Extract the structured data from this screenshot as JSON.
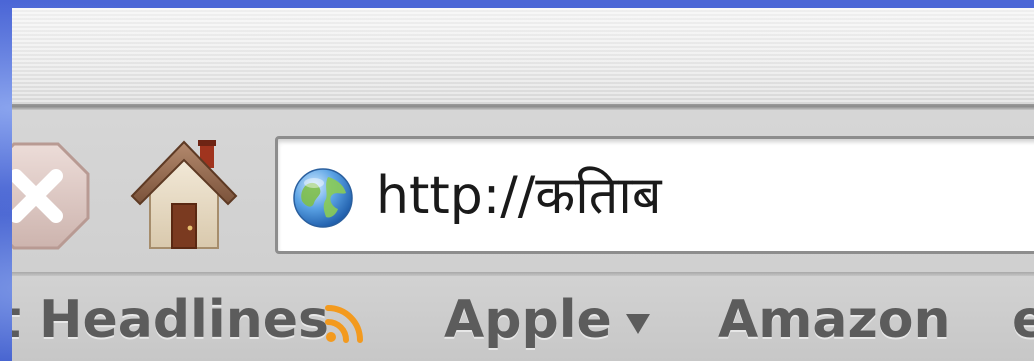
{
  "toolbar": {
    "stop_icon": "stop-x-icon",
    "home_icon": "home-icon"
  },
  "address_bar": {
    "icon": "globe-icon",
    "url": "http://कतिाब"
  },
  "bookmarks": [
    {
      "label": "t Headlines",
      "icon": "rss-icon"
    },
    {
      "label": "Apple",
      "icon": "dropdown-triangle-icon"
    },
    {
      "label": "Amazon"
    },
    {
      "label": "e"
    }
  ],
  "colors": {
    "desktop_blue": "#3f5fcf",
    "chrome_gray": "#d2d2d2",
    "rss_orange": "#f39a1e",
    "bookmark_text": "#5c5c5c"
  }
}
